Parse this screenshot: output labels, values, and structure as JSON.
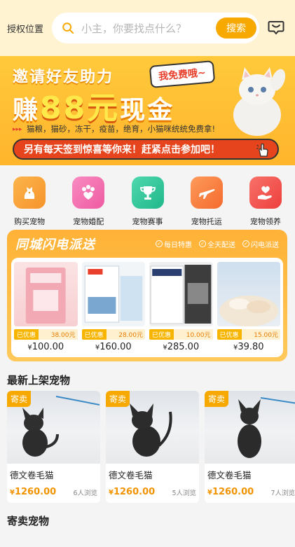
{
  "header": {
    "location": "授权位置",
    "search_placeholder": "小主，你要找点什么？",
    "search_button": "搜索"
  },
  "banner": {
    "line1": "邀请好友助力",
    "line2_prefix": "赚",
    "line2_amount": "88元",
    "line2_suffix": "现金",
    "tag": "我免费哦~",
    "arrows": "▸▸▸",
    "subtitle": "猫粮，猫砂，冻干，疫苗，绝育，小猫咪统统免费拿!",
    "cta": "另有每天签到惊喜等你来！赶紧点击参加吧！"
  },
  "nav": [
    {
      "label": "购买宠物",
      "icon": "dog-icon",
      "color": "#f9a23b"
    },
    {
      "label": "宠物婚配",
      "icon": "paw-heart-icon",
      "color": "#f26fb0"
    },
    {
      "label": "宠物赛事",
      "icon": "trophy-icon",
      "color": "#2ec79c"
    },
    {
      "label": "宠物托运",
      "icon": "plane-icon",
      "color": "#f97c3a"
    },
    {
      "label": "宠物领养",
      "icon": "heart-hand-icon",
      "color": "#f4504a"
    }
  ],
  "flash": {
    "title": "同城闪电派送",
    "tags": [
      "每日特惠",
      "全天配送",
      "闪电派送"
    ],
    "products": [
      {
        "coupon_label": "已优惠",
        "coupon_value": "38.00元",
        "currency": "¥",
        "price": "100.00"
      },
      {
        "coupon_label": "已优惠",
        "coupon_value": "28.00元",
        "currency": "¥",
        "price": "160.00"
      },
      {
        "coupon_label": "已优惠",
        "coupon_value": "10.00元",
        "currency": "¥",
        "price": "285.00"
      },
      {
        "coupon_label": "已优惠",
        "coupon_value": "15.00元",
        "currency": "¥",
        "price": "39.80"
      }
    ]
  },
  "latest": {
    "title": "最新上架宠物",
    "pets": [
      {
        "badge": "寄卖",
        "name": "德文卷毛猫",
        "currency": "¥",
        "price": "1260.00",
        "views": "6人浏览"
      },
      {
        "badge": "寄卖",
        "name": "德文卷毛猫",
        "currency": "¥",
        "price": "1260.00",
        "views": "5人浏览"
      },
      {
        "badge": "寄卖",
        "name": "德文卷毛猫",
        "currency": "¥",
        "price": "1260.00",
        "views": "7人浏览"
      }
    ]
  },
  "consign": {
    "title": "寄卖宠物"
  }
}
